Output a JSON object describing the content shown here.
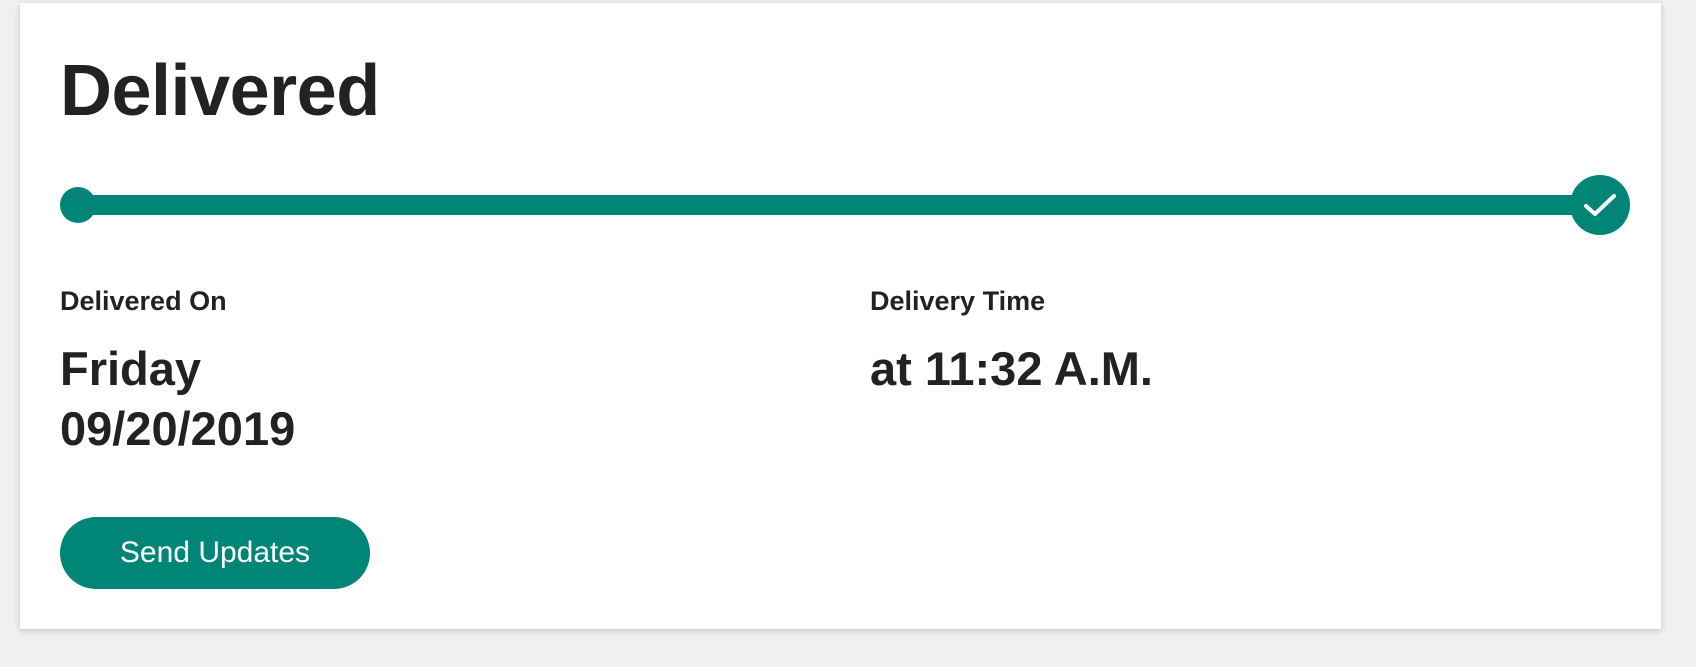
{
  "status": {
    "title": "Delivered"
  },
  "progress": {
    "percent": 100,
    "accent_color": "#008577",
    "start_marker": "dot",
    "end_icon": "checkmark-icon"
  },
  "details": {
    "delivered_on_label": "Delivered On",
    "delivered_day": "Friday",
    "delivered_date": "09/20/2019",
    "delivery_time_label": "Delivery Time",
    "delivery_time": "at 11:32 A.M."
  },
  "actions": {
    "send_updates_label": "Send Updates"
  }
}
